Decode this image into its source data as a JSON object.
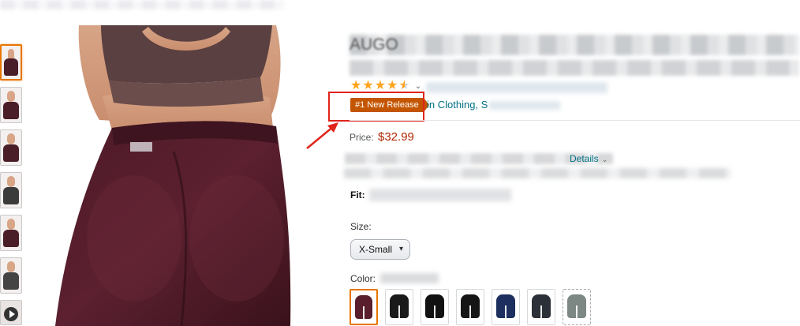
{
  "product": {
    "title_partial": "AUGO",
    "badge": {
      "text": "#1 New Release",
      "category_link": "in Clothing, S"
    },
    "price": {
      "label": "Price:",
      "value": "$32.99",
      "color": "#B12704"
    },
    "shipping_details_link": "Details",
    "fit_label": "Fit:",
    "size": {
      "label": "Size:",
      "selected": "X-Small"
    },
    "color_label": "Color:",
    "rating": {
      "stars": 4.5
    },
    "colors": {
      "badge_bg": "#C45500",
      "link": "#007185",
      "highlight": "#E0241B",
      "selected_border": "#E77600",
      "star": "#FFA41C"
    },
    "swatches": [
      {
        "name": "plum",
        "color": "#5a1f2c",
        "active": true
      },
      {
        "name": "black-1",
        "color": "#1a1a1a"
      },
      {
        "name": "black-2",
        "color": "#111111"
      },
      {
        "name": "black-3",
        "color": "#151515"
      },
      {
        "name": "navy",
        "color": "#1d2f5e"
      },
      {
        "name": "camo",
        "color": "#2c3038"
      },
      {
        "name": "grey",
        "color": "#7d8784",
        "dashed": true
      }
    ],
    "thumbnails": [
      {
        "name": "thumb-1",
        "active": true
      },
      {
        "name": "thumb-2"
      },
      {
        "name": "thumb-3"
      },
      {
        "name": "thumb-4"
      },
      {
        "name": "thumb-5"
      },
      {
        "name": "thumb-6"
      },
      {
        "name": "thumb-7-video"
      }
    ]
  }
}
